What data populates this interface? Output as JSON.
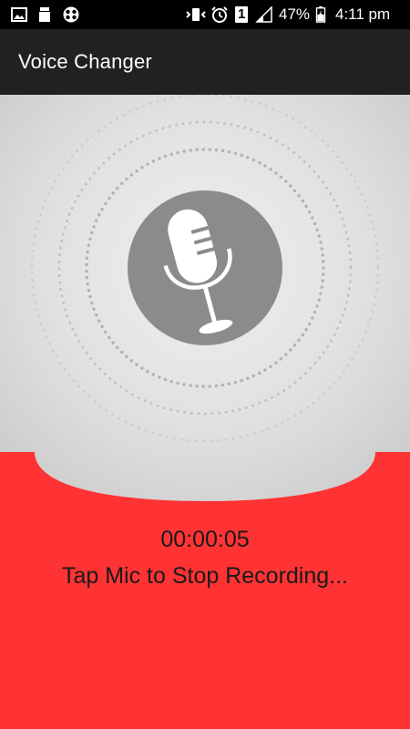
{
  "status_bar": {
    "battery_percent": "47%",
    "time": "4:11 pm",
    "sim_label": "1",
    "icons": [
      "image-icon",
      "storage-icon",
      "app-icon",
      "vibrate-icon",
      "alarm-icon",
      "sim-icon",
      "signal-icon",
      "battery-icon"
    ]
  },
  "app_bar": {
    "title": "Voice Changer"
  },
  "recorder": {
    "mic_icon": "microphone-icon",
    "elapsed_time": "00:00:05",
    "instruction": "Tap Mic to Stop Recording..."
  },
  "colors": {
    "accent_red": "#ff3333",
    "app_bar": "#212121",
    "mic_circle": "#8a8c8c",
    "ring_dots": "#a9a9a9"
  }
}
